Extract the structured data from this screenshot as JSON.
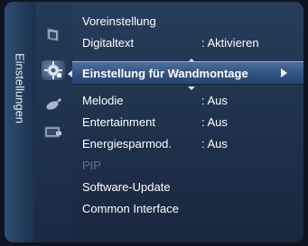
{
  "category": {
    "label": "Einstellungen"
  },
  "sidebar": {
    "icons": [
      "picture-icon",
      "settings-gear-icon",
      "satellite-dish-icon",
      "input-source-icon"
    ]
  },
  "menu": {
    "items": [
      {
        "label": "Voreinstellung",
        "value": ""
      },
      {
        "label": "Digitaltext",
        "value": ": Aktivieren"
      },
      {
        "label": "Einstellung für Wandmontage",
        "value": ""
      },
      {
        "label": "Melodie",
        "value": ": Aus"
      },
      {
        "label": "Entertainment",
        "value": ": Aus"
      },
      {
        "label": "Energiesparmod.",
        "value": ": Aus"
      },
      {
        "label": "PIP",
        "value": ""
      },
      {
        "label": "Software-Update",
        "value": ""
      },
      {
        "label": "Common Interface",
        "value": ""
      }
    ]
  },
  "colors": {
    "selected_row": "#2f5281",
    "disabled_text": "#5f7690",
    "text": "#ffffff"
  }
}
